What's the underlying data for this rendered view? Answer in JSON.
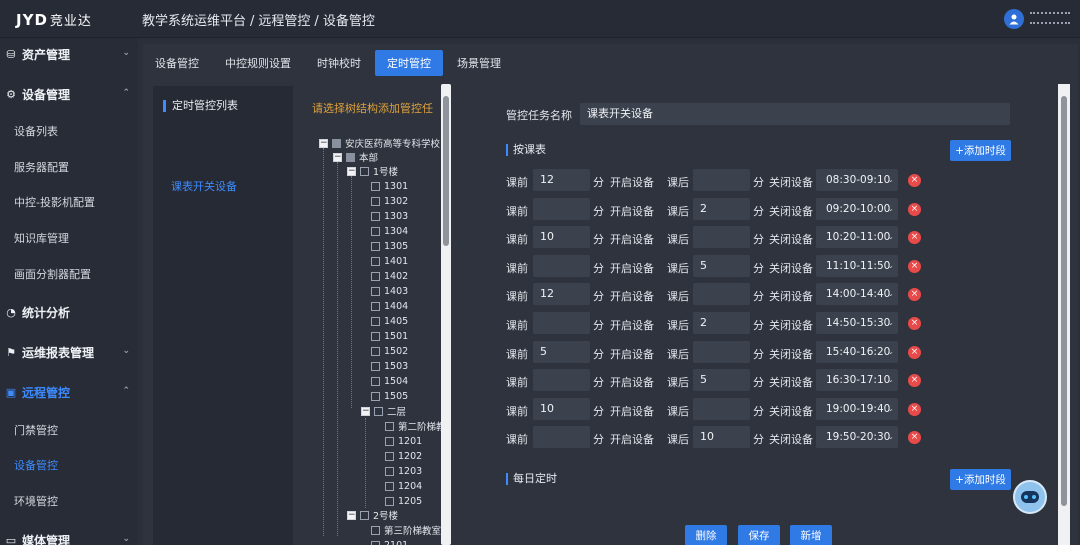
{
  "header": {
    "logo_latin": "JYD",
    "logo_cn": "竞业达",
    "crumb1": "教学系统运维平台",
    "crumb2": "远程管控",
    "crumb3": "设备管控",
    "sep": "/"
  },
  "sidebar": {
    "groups": [
      {
        "label": "资产管理",
        "icon": "database-icon",
        "chev": "⌄"
      },
      {
        "label": "设备管理",
        "icon": "gear-icon",
        "chev": "⌃"
      },
      {
        "label": "统计分析",
        "icon": "pie-chart-icon",
        "chev": ""
      },
      {
        "label": "运维报表管理",
        "icon": "chart-board-icon",
        "chev": "⌄"
      },
      {
        "label": "远程管控",
        "icon": "remote-icon",
        "chev": "⌃"
      },
      {
        "label": "媒体管理",
        "icon": "media-icon",
        "chev": "⌄"
      }
    ],
    "sub_device": [
      "设备列表",
      "服务器配置",
      "中控-投影机配置",
      "知识库管理",
      "画面分割器配置"
    ],
    "sub_remote": [
      "门禁管控",
      "设备管控",
      "环境管控"
    ]
  },
  "tabs": [
    "设备管控",
    "中控规则设置",
    "时钟校时",
    "定时管控",
    "场景管理"
  ],
  "active_tab": "定时管控",
  "left_panel": {
    "title": "定时管控列表",
    "item": "课表开关设备"
  },
  "tree": {
    "hint": "请选择树结构添加管控任",
    "school": "安庆医药高等专科学校",
    "campus": "本部",
    "building1": "1号楼",
    "rooms1": [
      "1301",
      "1302",
      "1303",
      "1304",
      "1305",
      "1401",
      "1402",
      "1403",
      "1404",
      "1405",
      "1501",
      "1502",
      "1503",
      "1504",
      "1505"
    ],
    "floor2": "二层",
    "floor2_rooms": [
      "第二阶梯教",
      "1201",
      "1202",
      "1203",
      "1204",
      "1205"
    ],
    "building2": "2号楼",
    "b2_rooms": [
      "第三阶梯教室",
      "2101"
    ]
  },
  "form": {
    "task_name_label": "管控任务名称",
    "task_name_value": "课表开关设备",
    "section_schedule": "按课表",
    "section_daily": "每日定时",
    "add_period_label": "+添加时段",
    "before_label": "课前",
    "after_label": "课后",
    "minute_label": "分",
    "open_label": "开启设备",
    "close_label": "关闭设备",
    "rows": [
      {
        "before": "12",
        "after": "",
        "time": "08:30-09:10"
      },
      {
        "before": "",
        "after": "2",
        "time": "09:20-10:00"
      },
      {
        "before": "10",
        "after": "",
        "time": "10:20-11:00"
      },
      {
        "before": "",
        "after": "5",
        "time": "11:10-11:50"
      },
      {
        "before": "12",
        "after": "",
        "time": "14:00-14:40"
      },
      {
        "before": "",
        "after": "2",
        "time": "14:50-15:30"
      },
      {
        "before": "5",
        "after": "",
        "time": "15:40-16:20"
      },
      {
        "before": "",
        "after": "5",
        "time": "16:30-17:10"
      },
      {
        "before": "10",
        "after": "",
        "time": "19:00-19:40"
      },
      {
        "before": "",
        "after": "10",
        "time": "19:50-20:30"
      }
    ],
    "delete_label": "删除",
    "save_label": "保存",
    "new_label": "新增"
  }
}
